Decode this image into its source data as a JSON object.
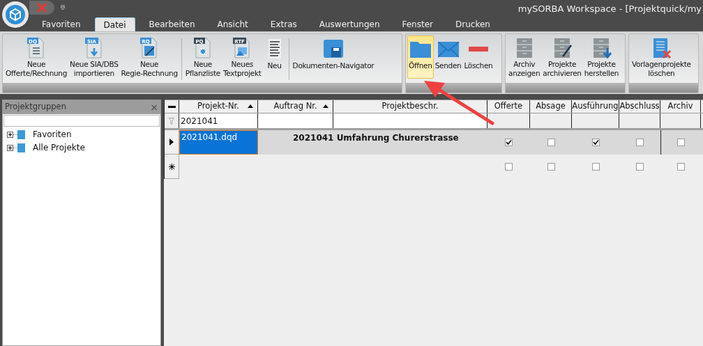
{
  "window": {
    "title": "mySORBA Workspace - [Projektquick/my"
  },
  "tabs": [
    {
      "label": "Favoriten",
      "selected": false
    },
    {
      "label": "Datei",
      "selected": true
    },
    {
      "label": "Bearbeiten",
      "selected": false
    },
    {
      "label": "Ansicht",
      "selected": false
    },
    {
      "label": "Extras",
      "selected": false
    },
    {
      "label": "Auswertungen",
      "selected": false
    },
    {
      "label": "Fenster",
      "selected": false
    },
    {
      "label": "Drucken",
      "selected": false
    }
  ],
  "ribbon": {
    "groups": [
      {
        "sections": [
          [
            {
              "lines": [
                "Neue",
                "Offerte/Rechnung"
              ],
              "kind": "doclist",
              "badge": "DQ",
              "selected": false
            },
            {
              "lines": [
                "Neue SIA/DBS",
                "importieren"
              ],
              "kind": "docdownload",
              "badge": "SIA",
              "selected": false
            },
            {
              "lines": [
                "Neue",
                "Regie-Rechnung"
              ],
              "kind": "docpen",
              "badge": "RQ",
              "selected": false
            }
          ],
          [
            {
              "lines": [
                "Neue",
                "Pflanzliste"
              ],
              "kind": "docgear",
              "badge": "PQ",
              "selected": false
            },
            {
              "lines": [
                "Neues",
                "Textprojekt"
              ],
              "kind": "docimage",
              "badge": "RTF",
              "selected": false
            },
            {
              "lines": [
                "Neu"
              ],
              "kind": "lines",
              "selected": false
            }
          ],
          [
            {
              "lines": [
                "Dokumenten-Navigator"
              ],
              "kind": "navigator",
              "selected": false
            }
          ]
        ]
      },
      {
        "sections": [
          [
            {
              "lines": [
                "Öffnen"
              ],
              "kind": "folder",
              "selected": true
            },
            {
              "lines": [
                "Senden"
              ],
              "kind": "mail",
              "selected": false
            },
            {
              "lines": [
                "Löschen"
              ],
              "kind": "minus",
              "selected": false
            }
          ]
        ]
      },
      {
        "sections": [
          [
            {
              "lines": [
                "Archiv",
                "anzeigen"
              ],
              "kind": "cabinet",
              "selected": false
            },
            {
              "lines": [
                "Projekte",
                "archivieren"
              ],
              "kind": "cabinetpen",
              "selected": false
            },
            {
              "lines": [
                "Projekte",
                "herstellen"
              ],
              "kind": "cabinetdown",
              "selected": false
            }
          ]
        ]
      },
      {
        "sections": [
          [
            {
              "lines": [
                "Vorlagenprojekte",
                "löschen"
              ],
              "kind": "docdelete",
              "selected": false
            }
          ]
        ]
      }
    ]
  },
  "sidebar": {
    "title": "Projektgruppen",
    "close": "×",
    "items": [
      {
        "label": "Favoriten",
        "expanded": false
      },
      {
        "label": "Alle Projekte",
        "expanded": false
      }
    ]
  },
  "grid": {
    "columns": [
      {
        "label": "Projekt-Nr.",
        "sorted": true
      },
      {
        "label": "Auftrag Nr.",
        "sorted": true
      },
      {
        "label": "Projektbeschr.",
        "sorted": false
      },
      {
        "label": "Offerte",
        "sorted": false
      },
      {
        "label": "Absage",
        "sorted": false
      },
      {
        "label": "Ausführung",
        "sorted": false
      },
      {
        "label": "Abschluss",
        "sorted": false
      },
      {
        "label": "Archiv",
        "sorted": false
      }
    ],
    "filter": {
      "projekt_nr": "2021041"
    },
    "rows": [
      {
        "kind": "data",
        "projekt_nr": "2021041.dqd",
        "beschreibung": "2021041 Umfahrung Churerstrasse",
        "checks": [
          true,
          false,
          true,
          false,
          false
        ]
      },
      {
        "kind": "new",
        "checks": [
          false,
          false,
          false,
          false,
          false
        ]
      }
    ]
  }
}
